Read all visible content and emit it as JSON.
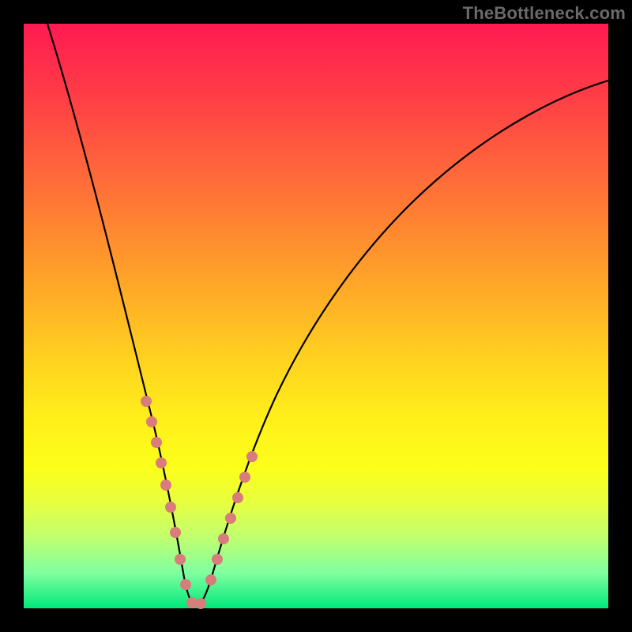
{
  "watermark": "TheBottleneck.com",
  "chart_data": {
    "type": "line",
    "title": "",
    "xlabel": "",
    "ylabel": "",
    "x": [
      0.0,
      0.05,
      0.1,
      0.15,
      0.2,
      0.23,
      0.26,
      0.28,
      0.3,
      0.35,
      0.4,
      0.45,
      0.5,
      0.55,
      0.6,
      0.65,
      0.7,
      0.75,
      0.8,
      0.85,
      0.9,
      0.95,
      1.0
    ],
    "values": [
      1.0,
      0.86,
      0.7,
      0.53,
      0.34,
      0.2,
      0.08,
      0.01,
      0.01,
      0.12,
      0.26,
      0.37,
      0.47,
      0.56,
      0.63,
      0.7,
      0.75,
      0.8,
      0.84,
      0.88,
      0.91,
      0.93,
      0.95
    ],
    "xlim": [
      0,
      1
    ],
    "ylim": [
      0,
      1
    ],
    "markers": {
      "x": [
        0.185,
        0.195,
        0.205,
        0.215,
        0.225,
        0.235,
        0.245,
        0.255,
        0.27,
        0.28,
        0.295,
        0.32,
        0.33,
        0.34,
        0.35,
        0.36,
        0.37,
        0.38
      ],
      "y": [
        0.41,
        0.37,
        0.33,
        0.29,
        0.25,
        0.21,
        0.17,
        0.12,
        0.05,
        0.015,
        0.015,
        0.07,
        0.11,
        0.14,
        0.17,
        0.2,
        0.23,
        0.26
      ]
    },
    "background_gradient": [
      "#ff1a52",
      "#ffd41f",
      "#fff01a",
      "#00e87a"
    ],
    "legend": false,
    "grid": false
  }
}
